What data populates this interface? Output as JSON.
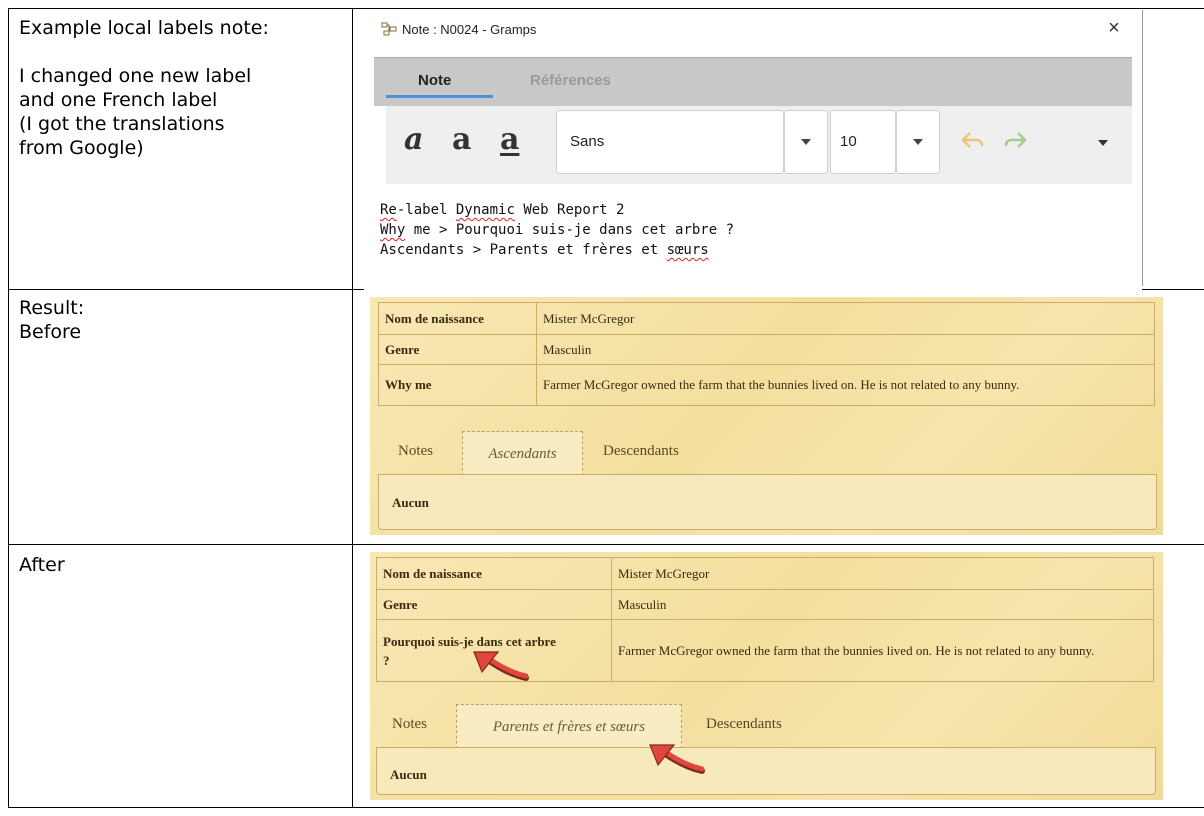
{
  "left_column": {
    "row1_lines": [
      "Example local labels note:",
      "",
      "I changed one new label",
      "and one French label",
      "(I got the translations",
      "from Google)"
    ],
    "row2_lines": [
      "Result:",
      "Before"
    ],
    "row3_lines": [
      "After"
    ]
  },
  "note_window": {
    "title": "Note : N0024 - Gramps",
    "close": "×",
    "tabs": [
      "Note",
      "Références"
    ],
    "format_buttons": [
      "a",
      "a",
      "a"
    ],
    "font_name": "Sans",
    "font_size": "10",
    "text_lines": [
      [
        "Re",
        "-label ",
        "Dynamic",
        " Web Report 2"
      ],
      [
        "Why",
        " me > Pourquoi suis-je dans cet arbre ?"
      ],
      [
        "Ascendants > Parents et frères et ",
        "sœurs",
        ""
      ]
    ]
  },
  "before_panel": {
    "rows": [
      {
        "label": "Nom de naissance",
        "value": "Mister McGregor"
      },
      {
        "label": "Genre",
        "value": "Masculin"
      },
      {
        "label": "Why me",
        "value": "Farmer McGregor owned the farm that the bunnies lived on. He is not related to any bunny."
      }
    ],
    "tabs": [
      "Notes",
      "Ascendants",
      "Descendants"
    ],
    "content": "Aucun"
  },
  "after_panel": {
    "rows": [
      {
        "label": "Nom de naissance",
        "value": "Mister McGregor"
      },
      {
        "label": "Genre",
        "value": "Masculin"
      },
      {
        "label": "Pourquoi suis-je dans cet arbre ?",
        "value": "Farmer McGregor owned the farm that the bunnies lived on. He is not related to any bunny."
      }
    ],
    "tabs": [
      "Notes",
      "Parents et frères et sœurs",
      "Descendants"
    ],
    "content": "Aucun"
  },
  "colors": {
    "accent": "#4a90d9",
    "arrow": "#e2463a",
    "parchment": "#f5e2a6",
    "table_border": "#c9ad6a"
  }
}
